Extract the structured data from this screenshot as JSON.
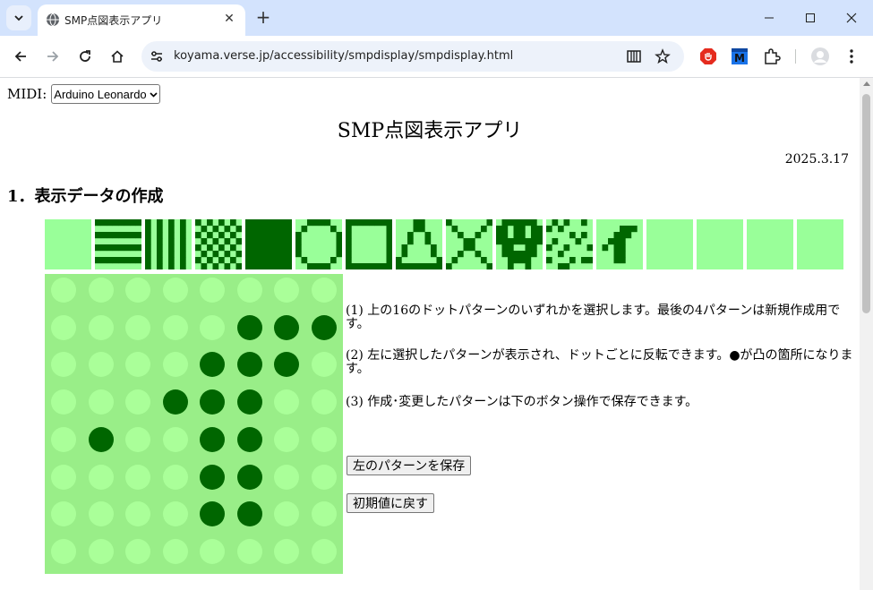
{
  "browser": {
    "tab_title": "SMP点図表示アプリ",
    "url": "koyama.verse.jp/accessibility/smpdisplay/smpdisplay.html"
  },
  "page": {
    "midi_label": "MIDI:",
    "midi_selected": "Arduino Leonardo",
    "title": "SMP点図表示アプリ",
    "date": "2025.3.17",
    "section_heading": "1．表示データの作成",
    "instructions": [
      "(1) 上の16のドットパターンのいずれかを選択します。最後の4パターンは新規作成用です。",
      "(2) 左に選択したパターンが表示され、ドットごとに反転できます。●が凸の箇所になります。",
      "(3) 作成･変更したパターンは下のボタン操作で保存できます。"
    ],
    "save_button": "左のパターンを保存",
    "reset_button": "初期値に戻す"
  },
  "colors": {
    "dot_on": "#006600",
    "dot_off": "#aaff99",
    "pattern_bg": "#99ff99",
    "editor_bg": "#99ee88"
  },
  "patterns": [
    {
      "name": "blank",
      "rows": [
        "00000000",
        "00000000",
        "00000000",
        "00000000",
        "00000000",
        "00000000",
        "00000000",
        "00000000"
      ]
    },
    {
      "name": "horizontal-stripes",
      "rows": [
        "11111111",
        "00000000",
        "11111111",
        "00000000",
        "11111111",
        "00000000",
        "11111111",
        "00000000"
      ]
    },
    {
      "name": "vertical-stripes",
      "rows": [
        "10101010",
        "10101010",
        "10101010",
        "10101010",
        "10101010",
        "10101010",
        "10101010",
        "10101010"
      ]
    },
    {
      "name": "checker",
      "rows": [
        "10101010",
        "01010101",
        "10101010",
        "01010101",
        "10101010",
        "01010101",
        "10101010",
        "01010101"
      ]
    },
    {
      "name": "solid",
      "rows": [
        "11111111",
        "11111111",
        "11111111",
        "11111111",
        "11111111",
        "11111111",
        "11111111",
        "11111111"
      ]
    },
    {
      "name": "circle",
      "rows": [
        "00111100",
        "01000010",
        "10000001",
        "10000001",
        "10000001",
        "10000001",
        "01000010",
        "00111100"
      ]
    },
    {
      "name": "square",
      "rows": [
        "11111111",
        "10000001",
        "10000001",
        "10000001",
        "10000001",
        "10000001",
        "10000001",
        "11111111"
      ]
    },
    {
      "name": "triangle",
      "rows": [
        "00011000",
        "00011000",
        "00100100",
        "00100100",
        "01000010",
        "01000010",
        "10000001",
        "11111111"
      ]
    },
    {
      "name": "cross",
      "rows": [
        "10000001",
        "01000010",
        "00100100",
        "00011000",
        "00011000",
        "00100100",
        "01000010",
        "10000001"
      ]
    },
    {
      "name": "figure",
      "rows": [
        "01111110",
        "11011011",
        "11011011",
        "11111111",
        "01100110",
        "01111110",
        "00111100",
        "00100100"
      ]
    },
    {
      "name": "scatter",
      "rows": [
        "01010010",
        "10100000",
        "00001010",
        "01000100",
        "10010001",
        "00100000",
        "10001011",
        "00110000"
      ]
    },
    {
      "name": "kana",
      "rows": [
        "00000000",
        "00001110",
        "00011100",
        "00111000",
        "01011000",
        "00011000",
        "00011000",
        "00000000"
      ]
    },
    {
      "name": "custom-1",
      "rows": [
        "00000000",
        "00000000",
        "00000000",
        "00000000",
        "00000000",
        "00000000",
        "00000000",
        "00000000"
      ]
    },
    {
      "name": "custom-2",
      "rows": [
        "00000000",
        "00000000",
        "00000000",
        "00000000",
        "00000000",
        "00000000",
        "00000000",
        "00000000"
      ]
    },
    {
      "name": "custom-3",
      "rows": [
        "00000000",
        "00000000",
        "00000000",
        "00000000",
        "00000000",
        "00000000",
        "00000000",
        "00000000"
      ]
    },
    {
      "name": "custom-4",
      "rows": [
        "00000000",
        "00000000",
        "00000000",
        "00000000",
        "00000000",
        "00000000",
        "00000000",
        "00000000"
      ]
    }
  ],
  "editor": {
    "rows": [
      "00000000",
      "00000111",
      "00001110",
      "00011100",
      "01001100",
      "00001100",
      "00001100",
      "00000000"
    ]
  }
}
